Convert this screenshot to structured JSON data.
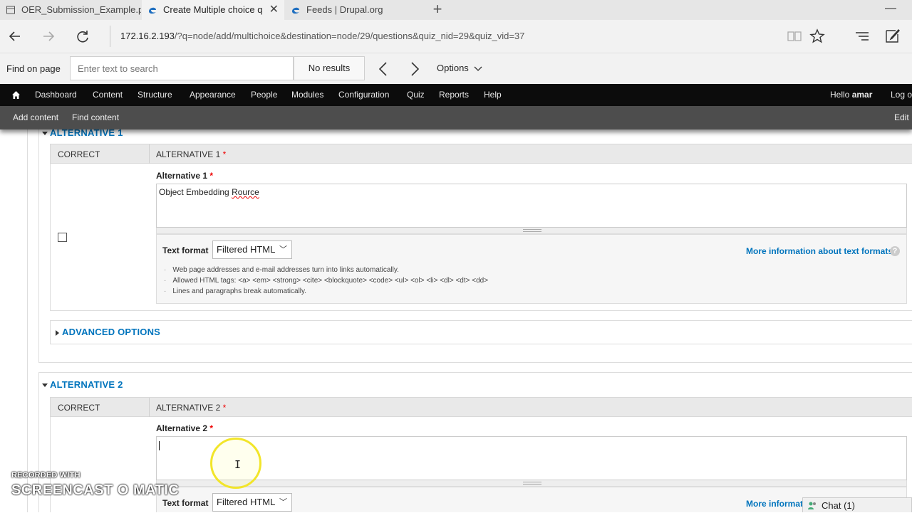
{
  "browser": {
    "tabs": [
      {
        "title": "OER_Submission_Example.p",
        "icon": "pdf-icon",
        "active": false
      },
      {
        "title": "Create Multiple choice q",
        "icon": "edge-icon",
        "active": true
      },
      {
        "title": "Feeds | Drupal.org",
        "icon": "edge-icon",
        "active": false
      }
    ],
    "new_tab": "+",
    "url_host": "172.16.2.193",
    "url_path": "/?q=node/add/multichoice&destination=node/29/questions&quiz_nid=29&quiz_vid=37"
  },
  "findbar": {
    "label": "Find on page",
    "placeholder": "Enter text to search",
    "results": "No results",
    "options": "Options"
  },
  "toolbar": {
    "items": [
      "Dashboard",
      "Content",
      "Structure",
      "Appearance",
      "People",
      "Modules",
      "Configuration",
      "Quiz",
      "Reports",
      "Help"
    ],
    "hello": "Hello",
    "user": "amar",
    "logout": "Log o"
  },
  "shortcuts": {
    "add_content": "Add content",
    "find_content": "Find content",
    "edit": "Edit"
  },
  "alt1": {
    "legend": "ALTERNATIVE 1",
    "col_correct": "CORRECT",
    "col_alt": "ALTERNATIVE 1",
    "required": "*",
    "field_label": "Alternative 1",
    "value_prefix": "Object Embedding ",
    "value_misspelled": "Rource",
    "correct_checked": false
  },
  "alt2": {
    "legend": "ALTERNATIVE 2",
    "col_correct": "CORRECT",
    "col_alt": "ALTERNATIVE 2",
    "required": "*",
    "field_label": "Alternative 2",
    "value": ""
  },
  "text_format": {
    "label": "Text format",
    "selected": "Filtered HTML",
    "more_info": "More information about text formats",
    "more_info_truncated": "More informati",
    "tips": [
      "Web page addresses and e-mail addresses turn into links automatically.",
      "Allowed HTML tags: <a> <em> <strong> <cite> <blockquote> <code> <ul> <ol> <li> <dl> <dt> <dd>",
      "Lines and paragraphs break automatically."
    ]
  },
  "advanced": {
    "label": "ADVANCED OPTIONS"
  },
  "overlay": {
    "watermark_top": "RECORDED WITH",
    "watermark_main": "SCREENCAST O MATIC",
    "chat": "Chat (1)"
  },
  "colors": {
    "link_blue": "#0074bd",
    "toolbar_black": "#0c0c0c",
    "shortcuts_gray": "#4d4d4d",
    "required_red": "#e00000",
    "cursor_highlight": "#f2e52a"
  }
}
